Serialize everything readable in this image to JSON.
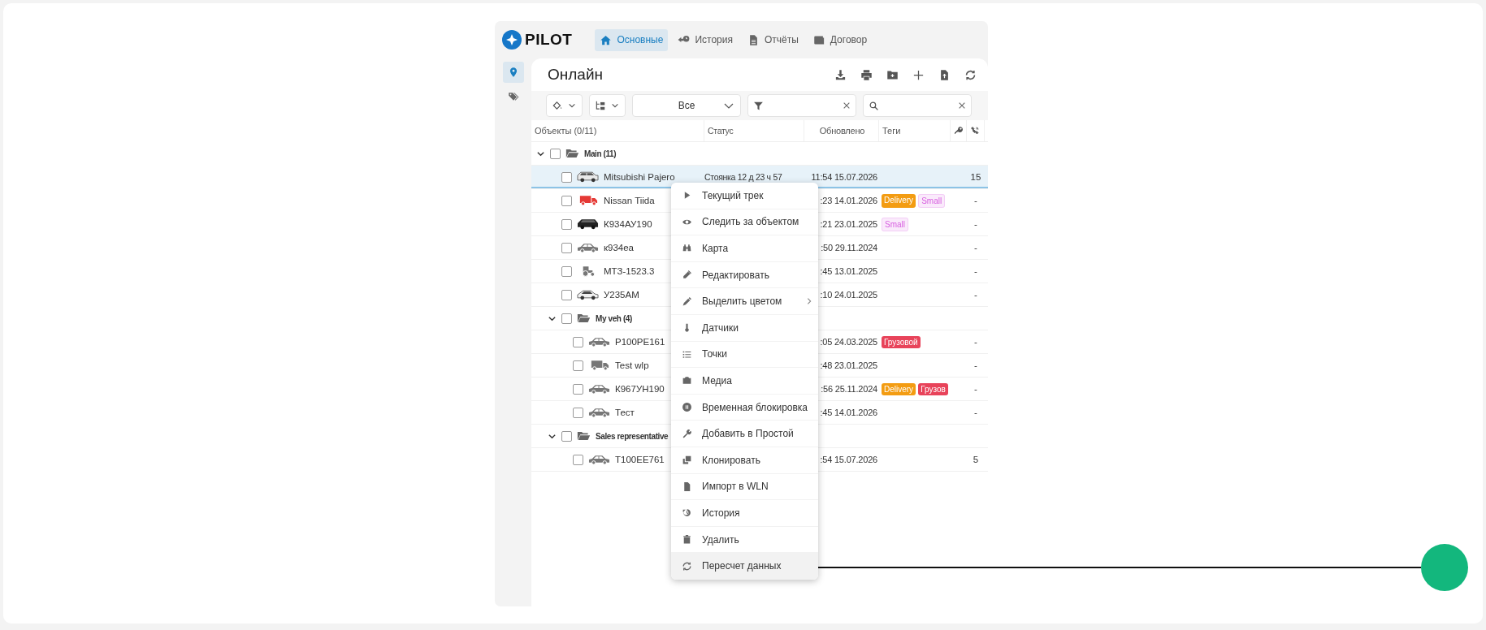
{
  "logo": "PILOT",
  "nav_tabs": [
    {
      "label": "Основные",
      "selected": true
    },
    {
      "label": "История",
      "selected": false
    },
    {
      "label": "Отчёты",
      "selected": false
    },
    {
      "label": "Договор",
      "selected": false
    }
  ],
  "sidebar": [
    {
      "selected": true
    },
    {
      "selected": false
    }
  ],
  "title": "Онлайн",
  "filters": {
    "dropdown": "Все"
  },
  "table": {
    "columns": [
      "Объекты (0/11)",
      "Статус",
      "Обновлено",
      "Теги"
    ],
    "rows": [
      {
        "kind": "group",
        "name": "Main (11)",
        "expanded": true,
        "checked": false,
        "children": [
          {
            "kind": "suv",
            "name": "Mitsubishi Pajero",
            "status": "Стоянка 12 д 23 ч 57",
            "updated": "11:54 15.07.2026",
            "column_6": "15",
            "checked": false,
            "selected": true
          },
          {
            "kind": "delivery-truck",
            "name": "Nissan Tiida",
            "updated": ":23 14.01.2026",
            "tags": [
              {
                "label": "Delivery",
                "kind": "solid",
                "color": "#f39c12"
              },
              {
                "label": "Small",
                "kind": "soft",
                "color": "#d75fe0"
              }
            ],
            "column_6": "-",
            "checked": false,
            "selected": false
          },
          {
            "kind": "minivan",
            "name": "К934АУ190",
            "updated": ":21 23.01.2025",
            "tags": [
              {
                "label": "Small",
                "kind": "soft",
                "color": "#d75fe0"
              }
            ],
            "column_6": "-",
            "checked": false,
            "selected": false
          },
          {
            "kind": "sedan",
            "name": "к934еа",
            "updated": ":50 29.11.2024",
            "column_6": "-",
            "checked": false,
            "selected": false
          },
          {
            "kind": "tractor",
            "name": "МТЗ-1523.3",
            "updated": ":45 13.01.2025",
            "column_6": "-",
            "checked": false,
            "selected": false
          },
          {
            "kind": "hatchback",
            "name": "У235АМ",
            "updated": ":10 24.01.2025",
            "column_6": "-",
            "checked": false,
            "selected": false
          },
          {
            "kind": "group",
            "name": "My veh (4)",
            "expanded": true,
            "checked": false,
            "children": [
              {
                "kind": "sedan",
                "name": "Р100РЕ161",
                "updated": ":05 24.03.2025",
                "tags": [
                  {
                    "label": "Грузовой",
                    "kind": "solid",
                    "color": "#e8435a"
                  }
                ],
                "column_6": "-",
                "checked": false,
                "selected": false
              },
              {
                "kind": "truck",
                "name": "Test wlp",
                "updated": ":48 23.01.2025",
                "column_6": "-",
                "checked": false,
                "selected": false
              },
              {
                "kind": "sedan",
                "name": "К967УН190",
                "updated": ":56 25.11.2024",
                "tags": [
                  {
                    "label": "Delivery",
                    "kind": "solid",
                    "color": "#f39c12"
                  },
                  {
                    "label": "Грузов",
                    "kind": "solid",
                    "color": "#e8435a"
                  }
                ],
                "column_6": "-",
                "checked": false,
                "selected": false
              },
              {
                "kind": "sedan",
                "name": "Тест",
                "updated": ":45 14.01.2026",
                "column_6": "-",
                "checked": false,
                "selected": false
              }
            ]
          },
          {
            "kind": "group",
            "name": "Sales representative",
            "expanded": true,
            "checked": false,
            "children": [
              {
                "kind": "sedan",
                "name": "Т100ЕЕ761",
                "updated": ":54 15.07.2026",
                "column_6": "5",
                "checked": false,
                "selected": false
              }
            ]
          }
        ]
      }
    ]
  },
  "context_menu": [
    {
      "label": "Текущий трек",
      "submenu": false,
      "selected": false
    },
    {
      "label": "Следить за объектом",
      "submenu": false,
      "selected": false
    },
    {
      "label": "Карта",
      "submenu": false,
      "selected": false
    },
    {
      "label": "Редактировать",
      "submenu": false,
      "selected": false
    },
    {
      "label": "Выделить цветом",
      "submenu": true,
      "selected": false
    },
    {
      "label": "Датчики",
      "submenu": false,
      "selected": false
    },
    {
      "label": "Точки",
      "submenu": false,
      "selected": false
    },
    {
      "label": "Медиа",
      "submenu": false,
      "selected": false
    },
    {
      "label": "Временная блокировка",
      "submenu": false,
      "selected": false
    },
    {
      "label": "Добавить в Простой",
      "submenu": false,
      "selected": false
    },
    {
      "label": "Клонировать",
      "submenu": false,
      "selected": false
    },
    {
      "label": "Импорт в WLN",
      "submenu": false,
      "selected": false
    },
    {
      "label": "История",
      "submenu": false,
      "selected": false
    },
    {
      "label": "Удалить",
      "submenu": false,
      "selected": false
    },
    {
      "label": "Пересчет данных",
      "submenu": false,
      "selected": true
    }
  ]
}
